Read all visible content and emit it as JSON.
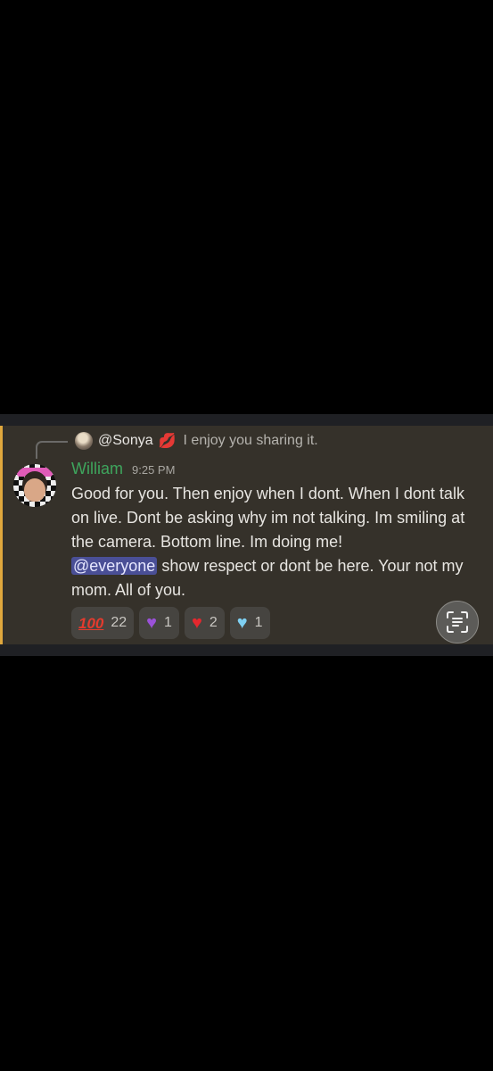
{
  "reply": {
    "author": "@Sonya",
    "emoji": "💋",
    "text": "I enjoy you sharing it."
  },
  "message": {
    "author": "William",
    "timestamp": "9:25 PM",
    "text_before": "Good for you. Then enjoy when I dont. When I dont talk on live. Dont be asking why im not talking. Im smiling at the camera. Bottom line. Im doing me!",
    "mention": "@everyone",
    "text_after": " show respect or dont be here. Your not my mom. All of you."
  },
  "reactions": [
    {
      "emoji": "💯",
      "icon": "hundred-points-icon",
      "count": "22"
    },
    {
      "emoji": "💜",
      "icon": "purple-heart-icon",
      "count": "1"
    },
    {
      "emoji": "❤️",
      "icon": "red-heart-icon",
      "count": "2"
    },
    {
      "emoji": "🩵",
      "icon": "light-blue-heart-icon",
      "count": "1"
    }
  ],
  "colors": {
    "username": "#3ea55d",
    "accent_bar": "#e0a73d",
    "mention_bg": "#4a4f96",
    "message_bg": "#35312a"
  },
  "icons": {
    "lens_button": "text-scan-icon"
  }
}
